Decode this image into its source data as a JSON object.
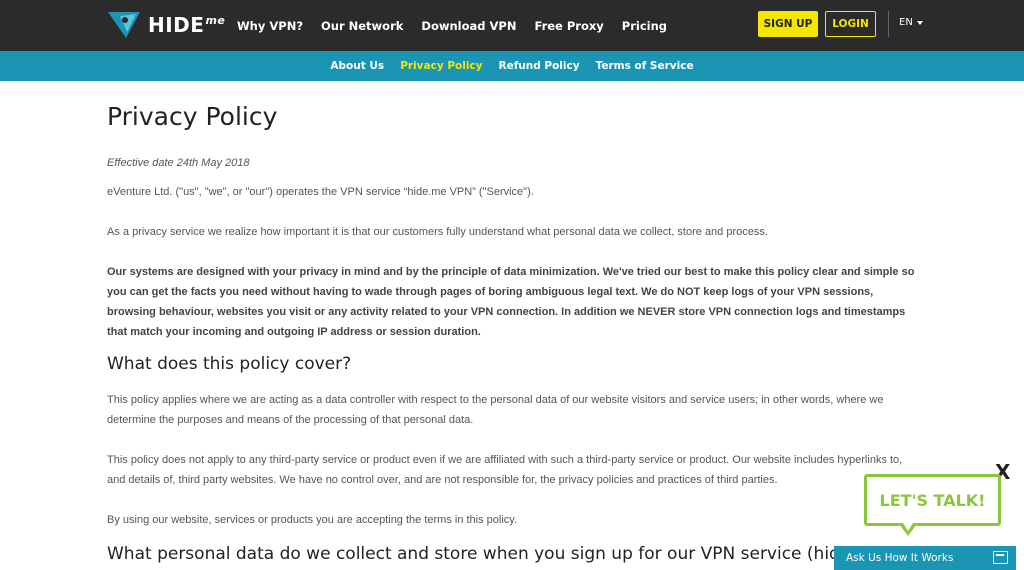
{
  "header": {
    "logo_text": "HIDE",
    "logo_sup": "me",
    "nav": [
      "Why VPN?",
      "Our Network",
      "Download VPN",
      "Free Proxy",
      "Pricing"
    ],
    "signup_label": "SIGN UP",
    "login_label": "LOGIN",
    "language": "EN"
  },
  "subnav": {
    "items": [
      "About Us",
      "Privacy Policy",
      "Refund Policy",
      "Terms of Service"
    ],
    "active": "Privacy Policy"
  },
  "page": {
    "title": "Privacy Policy",
    "effective_date": "Effective date 24th May 2018",
    "para1": "eVenture Ltd. (\"us\", \"we\", or \"our\") operates the VPN service “hide.me VPN” (\"Service\").",
    "para2": "As a privacy service we realize how important it is that our customers fully understand what personal data we collect, store and process.",
    "para3": "Our systems are designed with your privacy in mind and by the principle of data minimization. We've tried our best to make this policy clear and simple so you can get the facts you need without having to wade through pages of boring ambiguous legal text. We do NOT keep logs of your VPN sessions, browsing behaviour, websites you visit or any activity related to your VPN connection. In addition we NEVER store VPN connection logs and timestamps that match your incoming and outgoing IP address or session duration.",
    "heading2": "What does this policy cover?",
    "para4": "This policy applies where we are acting as a data controller with respect to the personal data of our website visitors and service users; in other words, where we determine the purposes and means of the processing of that personal data.",
    "para5": "This policy does not apply to any third-party service or product even if we are affiliated with such a third-party service or product. Our website includes hyperlinks to, and details of, third party websites. We have no control over, and are not responsible for, the privacy policies and practices of third parties.",
    "para6": "By using our website, services or products you are accepting the terms in this policy.",
    "heading3": "What personal data do we collect and store when you sign up for our VPN service (hide.me account data)?"
  },
  "chat": {
    "bubble_text": "LET'S TALK!",
    "close_label": "X",
    "ask_label": "Ask Us How It Works"
  },
  "colors": {
    "header_bg": "#2b2b2b",
    "subnav_bg": "#1a95b3",
    "accent_yellow": "#f5e600",
    "chat_green": "#8cc63f"
  }
}
